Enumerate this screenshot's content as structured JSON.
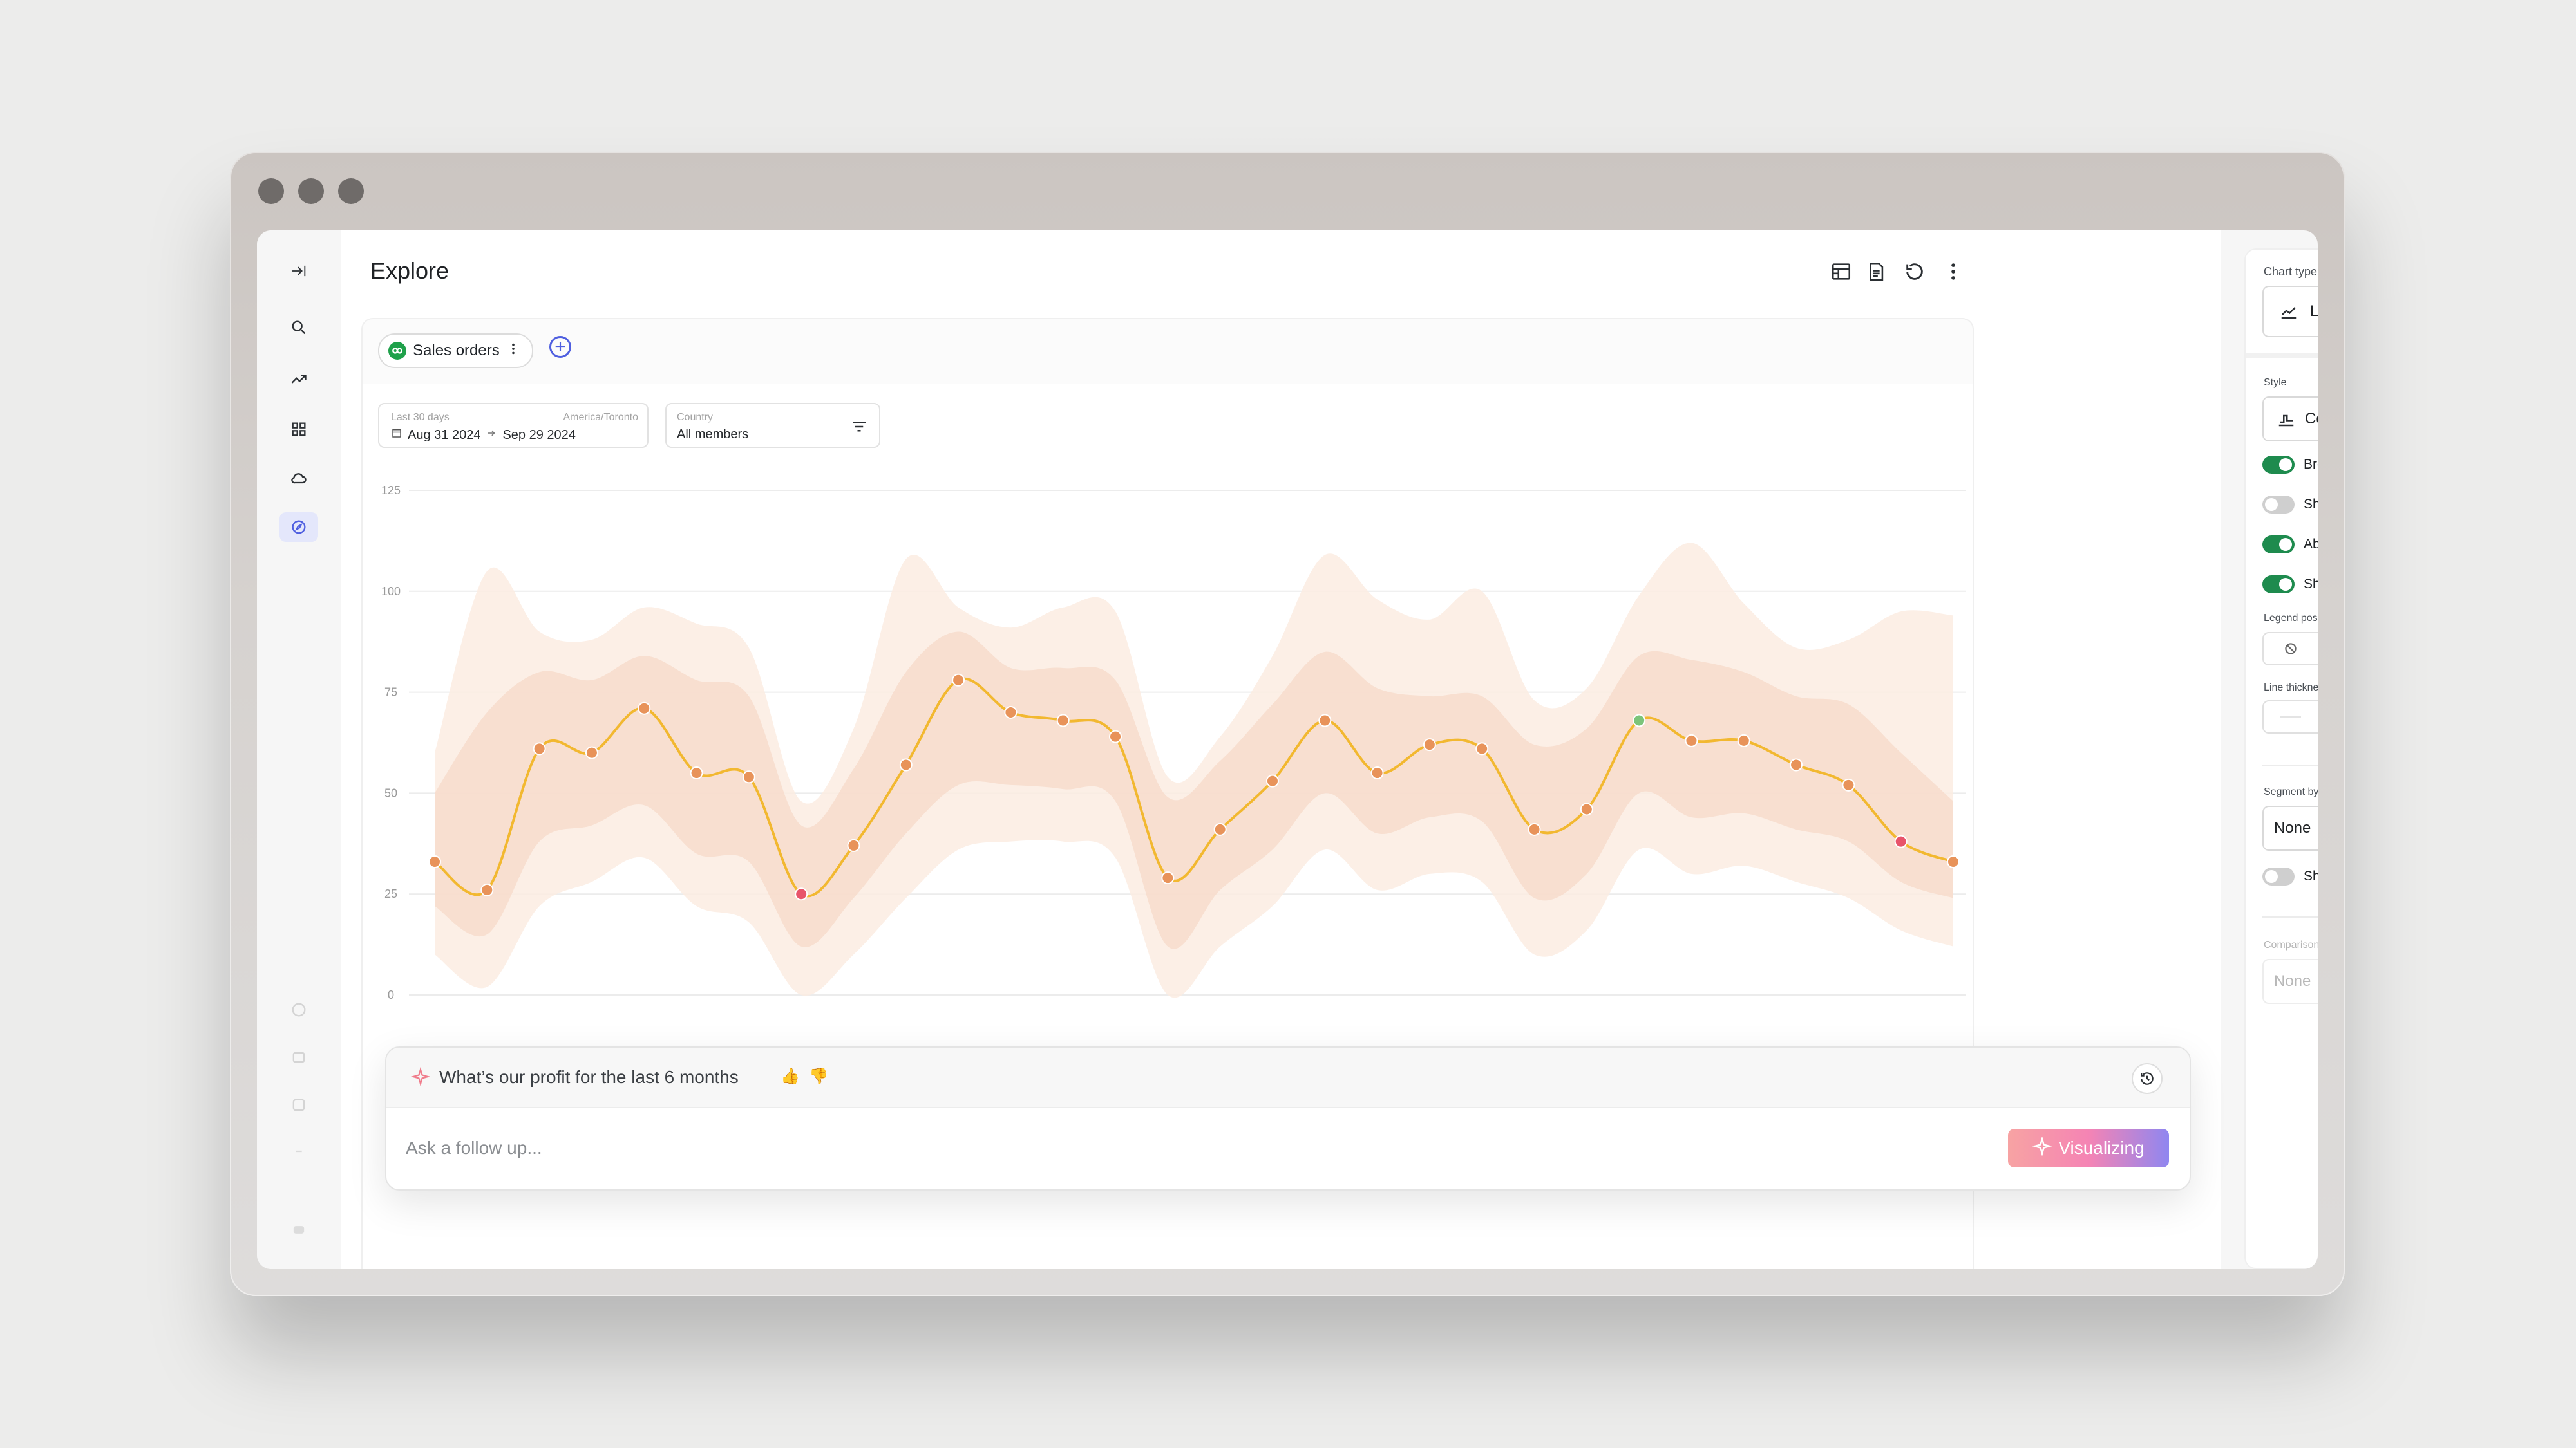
{
  "page": {
    "title": "Explore"
  },
  "source": {
    "label": "Sales orders"
  },
  "filters": {
    "date": {
      "label": "Last 30 days",
      "timezone": "America/Toronto",
      "start": "Aug 31 2024",
      "end": "Sep 29 2024"
    },
    "country": {
      "label": "Country",
      "value": "All members"
    }
  },
  "right_panel": {
    "chart_type": {
      "label": "Chart type",
      "value": "Line / Area"
    },
    "style": {
      "label": "Style",
      "value": "Column"
    },
    "toggles": [
      {
        "label": "Break lines for blank values",
        "on": true
      },
      {
        "label": "Show values as labels",
        "on": false
      },
      {
        "label": "Abbreviate long values",
        "on": true
      },
      {
        "label": "Show points",
        "on": true
      }
    ],
    "legend_position_label": "Legend position",
    "line_thickness_label": "Line thickness",
    "segment_by": {
      "label": "Segment by",
      "value": "None"
    },
    "show_total": {
      "label": "Show total",
      "on": false
    },
    "comparison": {
      "label": "Comparison",
      "value": "None"
    }
  },
  "ask": {
    "question": "What’s our profit for the last 6 months",
    "placeholder": "Ask a follow up...",
    "button": "Visualizing"
  },
  "colors": {
    "line": "#f2b830",
    "point": "#e8935a",
    "band_inner": "#f7dccb",
    "band_outer": "#fbece2",
    "accent": "#4f5fe0",
    "toggle_on": "#1e8b4e"
  },
  "chart_data": {
    "type": "area",
    "ylim": [
      0,
      125
    ],
    "yticks": [
      "125",
      "100",
      "75",
      "50",
      "25",
      "0"
    ],
    "grid": true,
    "series": [
      {
        "values": [
          33,
          26,
          61,
          60,
          71,
          55,
          54,
          25,
          37,
          57,
          78,
          70,
          68,
          64,
          29,
          41,
          53,
          68,
          55,
          62,
          61,
          41,
          46,
          68,
          63,
          63,
          57,
          52,
          38,
          33
        ]
      }
    ],
    "band_inner": {
      "low": [
        22,
        15,
        38,
        42,
        47,
        35,
        33,
        12,
        24,
        40,
        52,
        52,
        51,
        48,
        12,
        26,
        36,
        50,
        40,
        44,
        43,
        24,
        30,
        50,
        44,
        45,
        41,
        38,
        28,
        24
      ],
      "high": [
        50,
        70,
        80,
        78,
        84,
        78,
        74,
        42,
        56,
        80,
        90,
        81,
        81,
        78,
        49,
        58,
        72,
        85,
        76,
        74,
        74,
        62,
        66,
        84,
        83,
        80,
        74,
        72,
        60,
        48
      ]
    },
    "band_outer": {
      "low": [
        10,
        2,
        22,
        28,
        34,
        22,
        18,
        0,
        10,
        24,
        36,
        38,
        38,
        34,
        0,
        12,
        22,
        36,
        26,
        30,
        28,
        10,
        16,
        36,
        30,
        32,
        28,
        24,
        16,
        12
      ],
      "high": [
        60,
        105,
        90,
        88,
        96,
        92,
        86,
        48,
        66,
        108,
        96,
        91,
        96,
        95,
        54,
        64,
        84,
        109,
        98,
        93,
        100,
        73,
        76,
        99,
        112,
        97,
        86,
        88,
        95,
        94
      ]
    },
    "highlight_points": {
      "red": [
        7,
        28
      ],
      "green": [
        23
      ]
    }
  }
}
